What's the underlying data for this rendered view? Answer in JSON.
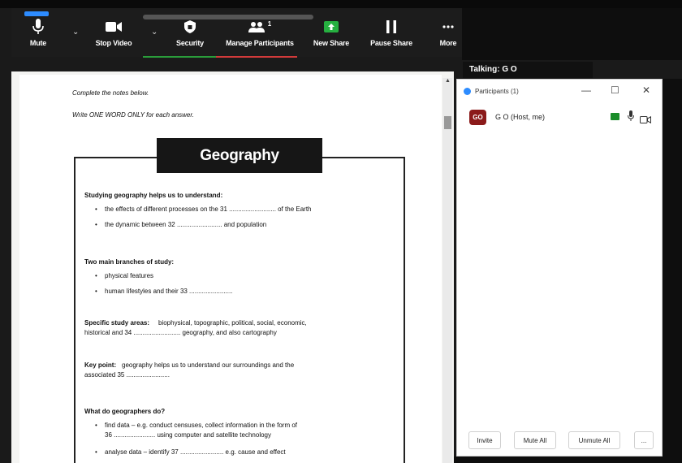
{
  "toolbar": {
    "mute_label": "Mute",
    "stop_video_label": "Stop Video",
    "security_label": "Security",
    "manage_participants_label": "Manage Participants",
    "participant_count": "1",
    "new_share_label": "New Share",
    "pause_share_label": "Pause Share",
    "more_label": "More"
  },
  "talking": "Talking: G O",
  "document": {
    "instruction1": "Complete the notes below.",
    "instruction2": "Write ONE WORD ONLY for each answer.",
    "title": "Geography",
    "s1_heading": "Studying geography helps us to understand:",
    "s1_b1": "the effects of different processes on the 31 .......................... of the Earth",
    "s1_b2": "the dynamic between 32 ......................... and population",
    "s2_heading": "Two main branches of study:",
    "s2_b1": "physical features",
    "s2_b2": "human lifestyles and their 33 ........................",
    "s3_heading": "Specific study areas:",
    "s3_text1": "biophysical, topographic, political, social, economic,",
    "s3_text2": "historical and 34 .......................... geography, and also cartography",
    "s4_heading": "Key point:",
    "s4_text1": "geography helps us to understand our surroundings and the",
    "s4_text2": "associated 35 ........................",
    "s5_heading": "What do geographers do?",
    "s5_b1_line1": "find data – e.g. conduct censuses, collect information in the form of",
    "s5_b1_line2": "36 ....................... using computer and satellite technology",
    "s5_b2": "analyse data – identify 37 ........................ e.g. cause and effect",
    "bullet_char": "•"
  },
  "participants_panel": {
    "title": "Participants (1)",
    "minimize": "—",
    "maximize": "☐",
    "close": "✕",
    "participant": {
      "initials": "GO",
      "name": "G O (Host, me)",
      "avatar_color": "#8b1a1a"
    },
    "invite_label": "Invite",
    "mute_all_label": "Mute All",
    "unmute_all_label": "Unmute All",
    "more_label": "..."
  },
  "colors": {
    "zoom_blue": "#2d8cff",
    "share_green": "#1a8d2a",
    "security_green": "#2a9d3a",
    "manage_red": "#d23a3a"
  }
}
